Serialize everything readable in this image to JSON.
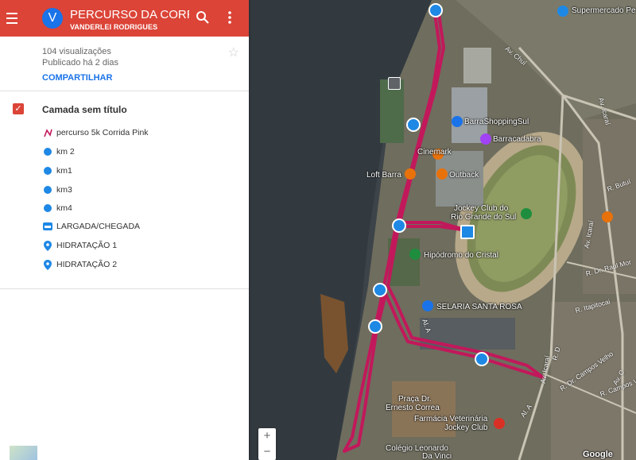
{
  "header": {
    "avatar_letter": "V",
    "title": "PERCURSO DA CORRI...",
    "owner": "VANDERLEI RODRIGUES"
  },
  "meta": {
    "views": "104 visualizações",
    "published": "Publicado há 2 dias",
    "share": "COMPARTILHAR"
  },
  "layer": {
    "name": "Camada sem título",
    "items": [
      {
        "label": "percurso 5k Corrida Pink",
        "icon": "route-line-icon"
      },
      {
        "label": "km 2",
        "icon": "runner-icon"
      },
      {
        "label": "km1",
        "icon": "runner-icon"
      },
      {
        "label": "km3",
        "icon": "runner-icon"
      },
      {
        "label": "km4",
        "icon": "runner-icon"
      },
      {
        "label": "LARGADA/CHEGADA",
        "icon": "bed-icon"
      },
      {
        "label": "HIDRATAÇÃO 1",
        "icon": "pin-icon"
      },
      {
        "label": "HIDRATAÇÃO 2",
        "icon": "pin-icon"
      }
    ]
  },
  "map": {
    "labels": {
      "supermercado": "Supermercado Pe",
      "barrashopping": "BarraShoppingSul",
      "barracadabra": "Barracadabra",
      "cinemark": "Cinemark",
      "loft": "Loft Barra",
      "outback": "Outback",
      "jockey1": "Jockey Club do",
      "jockey2": "Rio Grande do Sul",
      "hipodromo": "Hipódromo do Cristal",
      "selaria": "SELARIA SANTA ROSA",
      "praca1": "Praça Dr.",
      "praca2": "Ernesto Correa",
      "farmacia1": "Farmácia Veterinária",
      "farmacia2": "Jockey Club",
      "colegio1": "Colégio Leonardo",
      "colegio2": "Da Vinci",
      "google": "Google"
    },
    "roads": {
      "av_chui": "Av. Chuí",
      "icarai1": "Av. Icaraí",
      "icarai2": "Av. Icaraí",
      "icarai3": "Av. Icaraí",
      "butui": "R. Butuí",
      "raul": "R. Dr. Raul Mor",
      "itapitocai": "R. Itapitocai",
      "campos": "R. Dr. Campos Velho",
      "al_a": "Al. A",
      "al_a2": "Al. A",
      "camposv2": "R. Campos Velho",
      "av_c": "Av. C",
      "r_d": "R. D"
    },
    "zoom_in": "+",
    "zoom_out": "−"
  },
  "colors": {
    "header": "#db4437",
    "route": "#c2185b",
    "accent": "#1a73e8"
  }
}
